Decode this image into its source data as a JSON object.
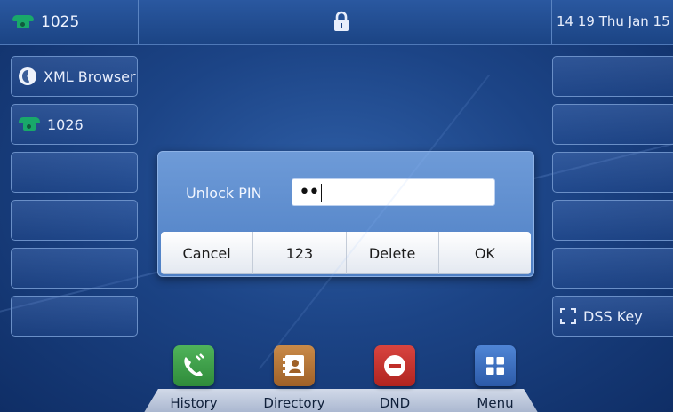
{
  "status_bar": {
    "account": "1025",
    "datetime": "14 19 Thu Jan 15",
    "lock_icon": "lock-icon"
  },
  "line_keys_left": [
    {
      "label": "XML Browser",
      "icon": "globe-icon"
    },
    {
      "label": "1026",
      "icon": "phone-icon"
    },
    {
      "label": ""
    },
    {
      "label": ""
    },
    {
      "label": ""
    },
    {
      "label": ""
    }
  ],
  "line_keys_right": [
    {
      "label": ""
    },
    {
      "label": ""
    },
    {
      "label": ""
    },
    {
      "label": ""
    },
    {
      "label": ""
    },
    {
      "label": "DSS Key",
      "icon": "dss-key-icon"
    }
  ],
  "dialog": {
    "label": "Unlock PIN",
    "pin_value": "••",
    "softkeys": [
      "Cancel",
      "123",
      "Delete",
      "OK"
    ]
  },
  "dock": [
    {
      "label": "History",
      "icon": "history-icon",
      "color": "#3d9a47"
    },
    {
      "label": "Directory",
      "icon": "directory-icon",
      "color": "#b8773a"
    },
    {
      "label": "DND",
      "icon": "dnd-icon",
      "color": "#c9342f"
    },
    {
      "label": "Menu",
      "icon": "menu-grid-icon",
      "color": "#3b6fc2"
    }
  ]
}
